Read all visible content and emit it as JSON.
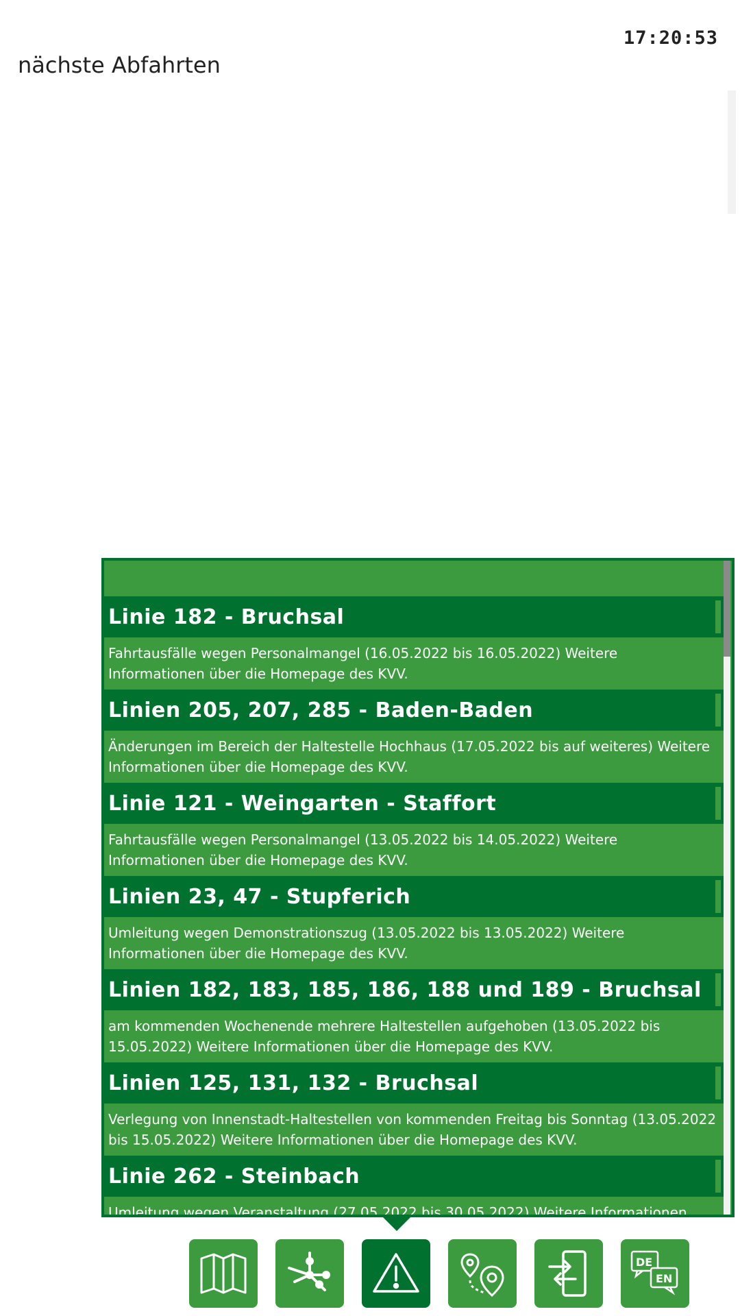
{
  "header": {
    "clock": "17:20:53",
    "title": "nächste Abfahrten"
  },
  "messages": [
    {
      "title": "Linie 182 - Bruchsal",
      "text": "Fahrtausfälle wegen Personalmangel (16.05.2022 bis 16.05.2022) Weitere Informationen über die Homepage des KVV."
    },
    {
      "title": "Linien 205, 207, 285 - Baden-Baden",
      "text": "Änderungen im Bereich der Haltestelle Hochhaus (17.05.2022 bis auf weiteres) Weitere Informationen über die Homepage des KVV."
    },
    {
      "title": "Linie 121 - Weingarten - Staffort",
      "text": "Fahrtausfälle wegen Personalmangel (13.05.2022 bis 14.05.2022) Weitere Informationen über die Homepage des KVV."
    },
    {
      "title": "Linien 23, 47 - Stupferich",
      "text": "Umleitung wegen Demonstrationszug (13.05.2022 bis 13.05.2022) Weitere Informationen über die Homepage des KVV."
    },
    {
      "title": "Linien 182, 183, 185, 186, 188 und 189 - Bruchsal",
      "text": "am kommenden Wochenende mehrere Haltestellen aufgehoben (13.05.2022 bis 15.05.2022) Weitere Informationen über die Homepage des KVV."
    },
    {
      "title": "Linien 125, 131, 132 - Bruchsal",
      "text": "Verlegung von Innenstadt-Haltestellen von kommenden Freitag bis Sonntag (13.05.2022 bis 15.05.2022) Weitere Informationen über die Homepage des KVV."
    },
    {
      "title": "Linie 262 - Steinbach",
      "text": "Umleitung wegen Veranstaltung (27.05.2022 bis 30.05.2022) Weitere Informationen"
    }
  ],
  "toolbar": {
    "icons": [
      "map-icon",
      "network-icon",
      "warning-icon",
      "route-icon",
      "phone-transfer-icon",
      "language-icon"
    ],
    "active": "warning-icon",
    "lang_de": "DE",
    "lang_en": "EN"
  },
  "colors": {
    "dark_green": "#00712f",
    "light_green": "#3d9b3f",
    "text": "#222222"
  }
}
